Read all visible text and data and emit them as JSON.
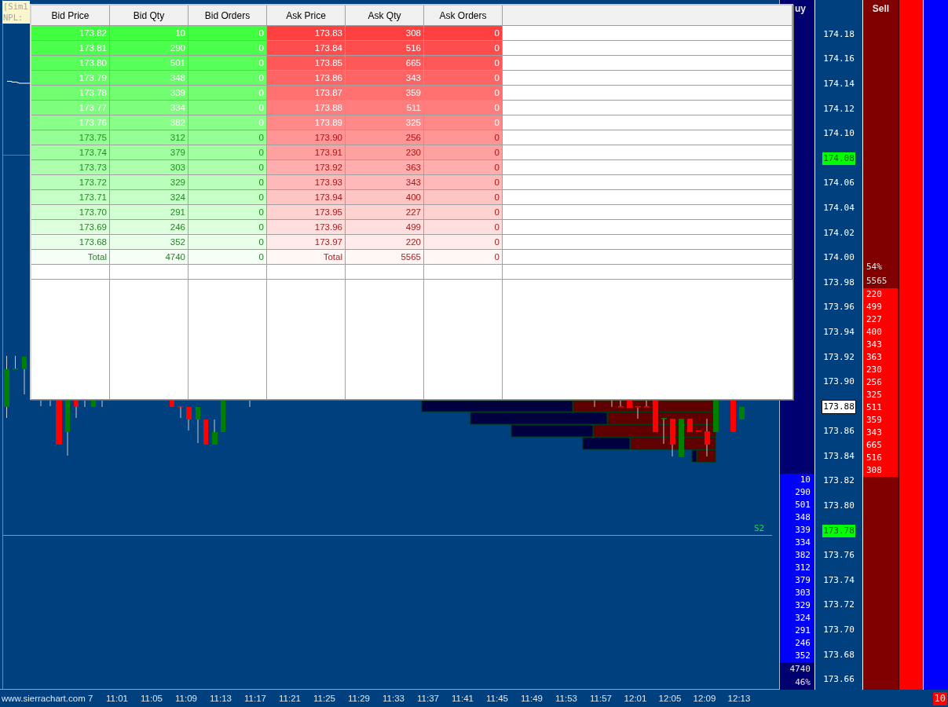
{
  "account_box": {
    "lines": [
      "[Sim1",
      "NPL:"
    ]
  },
  "chart": {
    "line_label": "S2"
  },
  "depth_table": {
    "columns": [
      "Bid Price",
      "Bid Qty",
      "Bid Orders",
      "Ask Price",
      "Ask Qty",
      "Ask Orders"
    ],
    "rows": [
      {
        "bid_price": "173.82",
        "bid_qty": "10",
        "bid_orders": "0",
        "ask_price": "173.83",
        "ask_qty": "308",
        "ask_orders": "0"
      },
      {
        "bid_price": "173.81",
        "bid_qty": "290",
        "bid_orders": "0",
        "ask_price": "173.84",
        "ask_qty": "516",
        "ask_orders": "0"
      },
      {
        "bid_price": "173.80",
        "bid_qty": "501",
        "bid_orders": "0",
        "ask_price": "173.85",
        "ask_qty": "665",
        "ask_orders": "0"
      },
      {
        "bid_price": "173.79",
        "bid_qty": "348",
        "bid_orders": "0",
        "ask_price": "173.86",
        "ask_qty": "343",
        "ask_orders": "0"
      },
      {
        "bid_price": "173.78",
        "bid_qty": "339",
        "bid_orders": "0",
        "ask_price": "173.87",
        "ask_qty": "359",
        "ask_orders": "0"
      },
      {
        "bid_price": "173.77",
        "bid_qty": "334",
        "bid_orders": "0",
        "ask_price": "173.88",
        "ask_qty": "511",
        "ask_orders": "0"
      },
      {
        "bid_price": "173.76",
        "bid_qty": "382",
        "bid_orders": "0",
        "ask_price": "173.89",
        "ask_qty": "325",
        "ask_orders": "0"
      },
      {
        "bid_price": "173.75",
        "bid_qty": "312",
        "bid_orders": "0",
        "ask_price": "173.90",
        "ask_qty": "256",
        "ask_orders": "0"
      },
      {
        "bid_price": "173.74",
        "bid_qty": "379",
        "bid_orders": "0",
        "ask_price": "173.91",
        "ask_qty": "230",
        "ask_orders": "0"
      },
      {
        "bid_price": "173.73",
        "bid_qty": "303",
        "bid_orders": "0",
        "ask_price": "173.92",
        "ask_qty": "363",
        "ask_orders": "0"
      },
      {
        "bid_price": "173.72",
        "bid_qty": "329",
        "bid_orders": "0",
        "ask_price": "173.93",
        "ask_qty": "343",
        "ask_orders": "0"
      },
      {
        "bid_price": "173.71",
        "bid_qty": "324",
        "bid_orders": "0",
        "ask_price": "173.94",
        "ask_qty": "400",
        "ask_orders": "0"
      },
      {
        "bid_price": "173.70",
        "bid_qty": "291",
        "bid_orders": "0",
        "ask_price": "173.95",
        "ask_qty": "227",
        "ask_orders": "0"
      },
      {
        "bid_price": "173.69",
        "bid_qty": "246",
        "bid_orders": "0",
        "ask_price": "173.96",
        "ask_qty": "499",
        "ask_orders": "0"
      },
      {
        "bid_price": "173.68",
        "bid_qty": "352",
        "bid_orders": "0",
        "ask_price": "173.97",
        "ask_qty": "220",
        "ask_orders": "0"
      }
    ],
    "total": {
      "bid_price": "Total",
      "bid_qty": "4740",
      "bid_orders": "0",
      "ask_price": "Total",
      "ask_qty": "5565",
      "ask_orders": "0"
    }
  },
  "buy_column": {
    "header": "uy",
    "quantities": [
      "10",
      "290",
      "501",
      "348",
      "339",
      "334",
      "382",
      "312",
      "379",
      "303",
      "329",
      "324",
      "291",
      "246",
      "352"
    ],
    "total": "4740",
    "percent": "46%"
  },
  "price_scale": {
    "labels": [
      {
        "text": "174.18",
        "kind": "plain"
      },
      {
        "text": "174.16",
        "kind": "plain"
      },
      {
        "text": "174.14",
        "kind": "plain"
      },
      {
        "text": "174.12",
        "kind": "plain"
      },
      {
        "text": "174.10",
        "kind": "plain"
      },
      {
        "text": "174.08",
        "kind": "marker"
      },
      {
        "text": "174.06",
        "kind": "plain"
      },
      {
        "text": "174.04",
        "kind": "plain"
      },
      {
        "text": "174.02",
        "kind": "plain"
      },
      {
        "text": "174.00",
        "kind": "plain"
      },
      {
        "text": "173.98",
        "kind": "plain"
      },
      {
        "text": "173.96",
        "kind": "plain"
      },
      {
        "text": "173.94",
        "kind": "plain"
      },
      {
        "text": "173.92",
        "kind": "plain"
      },
      {
        "text": "173.90",
        "kind": "plain"
      },
      {
        "text": "173.88",
        "kind": "current"
      },
      {
        "text": "173.86",
        "kind": "plain"
      },
      {
        "text": "173.84",
        "kind": "plain"
      },
      {
        "text": "173.82",
        "kind": "plain"
      },
      {
        "text": "173.80",
        "kind": "plain"
      },
      {
        "text": "173.78",
        "kind": "marker"
      },
      {
        "text": "173.76",
        "kind": "plain"
      },
      {
        "text": "173.74",
        "kind": "plain"
      },
      {
        "text": "173.72",
        "kind": "plain"
      },
      {
        "text": "173.70",
        "kind": "plain"
      },
      {
        "text": "173.68",
        "kind": "plain"
      },
      {
        "text": "173.66",
        "kind": "plain"
      }
    ]
  },
  "sell_column": {
    "header": "Sell",
    "percent": "54%",
    "total": "5565",
    "quantities": [
      "220",
      "499",
      "227",
      "400",
      "343",
      "363",
      "230",
      "256",
      "325",
      "511",
      "359",
      "343",
      "665",
      "516",
      "308"
    ]
  },
  "time_axis": {
    "website": "www.sierrachart.com",
    "cut_label": "7",
    "labels": [
      "11:01",
      "11:05",
      "11:09",
      "11:13",
      "11:17",
      "11:21",
      "11:25",
      "11:29",
      "11:33",
      "11:37",
      "11:41",
      "11:45",
      "11:49",
      "11:53",
      "11:57",
      "12:01",
      "12:05",
      "12:09",
      "12:13"
    ]
  },
  "status_badge": "10"
}
